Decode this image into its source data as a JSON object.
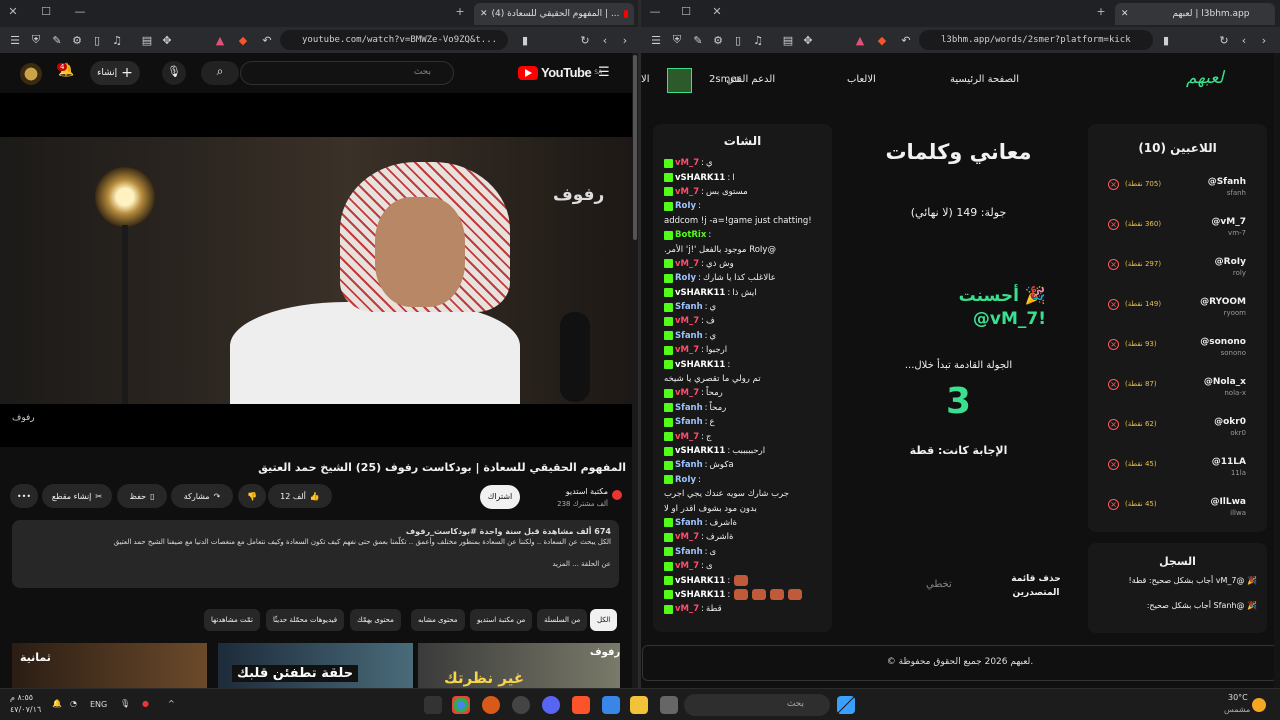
{
  "left_browser": {
    "tab_title": "(4) المفهوم الحقيقي للسعادة | ...",
    "url": "youtube.com/watch?v=BMWZe-Vo9ZQ&t...",
    "youtube": {
      "logo_text": "YouTube",
      "logo_region": "SA",
      "search_placeholder": "بحث",
      "create_label": "إنشاء",
      "notifications_count": "4"
    },
    "video": {
      "brand_overlay": "رفوف",
      "brand_small": "رفوف",
      "title": "المفهوم الحقيقي للسعادة | بودكاست رفوف (25) الشيخ حمد العتيق",
      "channel_name": "مكتبة استديو",
      "subscribers": "238 ألف مشترك",
      "join_label": "اشتراك",
      "likes": "12 ألف",
      "share_label": "مشاركة",
      "save_label": "حفظ",
      "clip_label": "إنشاء مقطع",
      "desc_stats": "674 ألف مشاهدة  قبل سنة واحدة  #بودكاست_رفوف",
      "desc_text": "الكل يبحث عن السعادة .. ولكننا عن السعادة بمنظور مختلف وأعمق .. تكلّمنا بعمق حتى نفهم كيف تكون السعادة وكيف نتعامل مع منغصات الدنيا مع ضيفنا الشيخ حمد العتيق",
      "desc_more": "عن الحلقة ... المزيد"
    },
    "chips": [
      "الكل",
      "من السلسلة",
      "من مكتبة استديو",
      "محتوى مشابه",
      "محتوى يهمّك",
      "فيديوهات محمّلة حديثًا",
      "تمّت مشاهدتها"
    ],
    "thumbs": [
      "ثمانية",
      "حلقة تطفئن قلبك",
      "غير نظرتك",
      "رفوف"
    ]
  },
  "right_browser": {
    "tab_title": "لعبهم | l3bhm.app",
    "url": "l3bhm.app/words/2smer?platform=kick",
    "site": {
      "logo": "لعبهم",
      "nav": [
        "الصفحة الرئيسية",
        "الالعاب",
        "الدعم الفني"
      ],
      "username": "2smer",
      "nav_more": "الا"
    },
    "chat": {
      "title": "الشات",
      "messages": [
        {
          "user": "vM_7",
          "text": "ي",
          "color": "#ff4d6d",
          "rtl": true
        },
        {
          "user": "vSHARK11",
          "text": "ا",
          "color": "#ffffff",
          "rtl": true
        },
        {
          "user": "vM_7",
          "text": "مستوى بس",
          "color": "#ff4d6d",
          "rtl": true
        },
        {
          "user": "RoIy",
          "text": "",
          "color": "#9ec3ff",
          "rtl": false
        },
        {
          "user": "",
          "text": "!addcom !j -a=!game just chatting",
          "color": "#ffffff",
          "rtl": false
        },
        {
          "user": "BotRix",
          "text": "",
          "color": "#53fc18",
          "rtl": false
        },
        {
          "user": "",
          "text": "@RoIy موجود بالفعل '!j' الأمر.",
          "color": "#ffffff",
          "rtl": false
        },
        {
          "user": "vM_7",
          "text": "وش ذي",
          "color": "#ff4d6d",
          "rtl": true
        },
        {
          "user": "RoIy",
          "text": "عالاغلب كذا يا شارك",
          "color": "#9ec3ff",
          "rtl": true
        },
        {
          "user": "vSHARK11",
          "text": "ايش ذا",
          "color": "#ffffff",
          "rtl": true
        },
        {
          "user": "Sfanh",
          "text": "ي",
          "color": "#9ec3ff",
          "rtl": true
        },
        {
          "user": "vM_7",
          "text": "ف",
          "color": "#ff4d6d",
          "rtl": true
        },
        {
          "user": "Sfanh",
          "text": "ي",
          "color": "#9ec3ff",
          "rtl": true
        },
        {
          "user": "vM_7",
          "text": "ارجبوا",
          "color": "#ff4d6d",
          "rtl": true
        },
        {
          "user": "vSHARK11",
          "text": "",
          "color": "#ffffff",
          "rtl": false
        },
        {
          "user": "",
          "text": "تم رولي ما تقصري يا شيخه",
          "color": "#ffffff",
          "rtl": true
        },
        {
          "user": "vM_7",
          "text": "رمحاً",
          "color": "#ff4d6d",
          "rtl": true
        },
        {
          "user": "Sfanh",
          "text": "رمحاً",
          "color": "#9ec3ff",
          "rtl": true
        },
        {
          "user": "Sfanh",
          "text": "ع",
          "color": "#9ec3ff",
          "rtl": true
        },
        {
          "user": "vM_7",
          "text": "ج",
          "color": "#ff4d6d",
          "rtl": true
        },
        {
          "user": "vSHARK11",
          "text": "ارحبببببب",
          "color": "#ffffff",
          "rtl": true
        },
        {
          "user": "Sfanh",
          "text": "aكوش",
          "color": "#9ec3ff",
          "rtl": true
        },
        {
          "user": "RoIy",
          "text": "",
          "color": "#9ec3ff",
          "rtl": false
        },
        {
          "user": "",
          "text": "جرب شارك سويه عندك يجي اجرب",
          "color": "#ffffff",
          "rtl": true
        },
        {
          "user": "",
          "text": "بدون مود بشوف اقدر او لا",
          "color": "#ffffff",
          "rtl": true
        },
        {
          "user": "Sfanh",
          "text": "ةاشرف",
          "color": "#9ec3ff",
          "rtl": true
        },
        {
          "user": "vM_7",
          "text": "ةاشرف",
          "color": "#ff4d6d",
          "rtl": true
        },
        {
          "user": "Sfanh",
          "text": "ى",
          "color": "#9ec3ff",
          "rtl": true
        },
        {
          "user": "vM_7",
          "text": "ى",
          "color": "#ff4d6d",
          "rtl": true
        },
        {
          "user": "vSHARK11",
          "text": "",
          "color": "#ffffff",
          "rtl": false,
          "emotes": 1
        },
        {
          "user": "vSHARK11",
          "text": "",
          "color": "#ffffff",
          "rtl": false,
          "emotes": 4
        },
        {
          "user": "vM_7",
          "text": "قطة",
          "color": "#ff4d6d",
          "rtl": true
        }
      ]
    },
    "game": {
      "title": "معاني وكلمات",
      "round": "جولة: 149 (لا نهائي)",
      "good_line1": "🎉 أحسنت",
      "good_line2": "@vM_7!",
      "next_round": "الجولة القادمة تبدأ خلال...",
      "countdown": "3",
      "answer": "الإجابة كانت: قطة",
      "skip_label": "تخطي",
      "clear_label": "حذف قائمة المتصدرين"
    },
    "players": {
      "title": "اللاعبين (10)",
      "list": [
        {
          "name": "@Sfanh",
          "sub": "sfanh",
          "points": "(705 نقطة)"
        },
        {
          "name": "@vM_7",
          "sub": "vm-7",
          "points": "(360 نقطة)"
        },
        {
          "name": "@RoIy",
          "sub": "roly",
          "points": "(297 نقطة)"
        },
        {
          "name": "@RYOOM",
          "sub": "ryoom",
          "points": "(149 نقطة)"
        },
        {
          "name": "@sonono",
          "sub": "sonono",
          "points": "(93 نقطة)"
        },
        {
          "name": "@Nola_x",
          "sub": "nola-x",
          "points": "(87 نقطة)"
        },
        {
          "name": "@okr0",
          "sub": "okr0",
          "points": "(62 نقطة)"
        },
        {
          "name": "@11LA",
          "sub": "11la",
          "points": "(45 نقطة)"
        },
        {
          "name": "@IlLwa",
          "sub": "illwa",
          "points": "(45 نقطة)"
        }
      ]
    },
    "log": {
      "title": "السجل",
      "lines": [
        "🎉 @vM_7 أجاب بشكل صحيح: قطة!",
        "🎉 @Sfanh أجاب بشكل صحيح:"
      ]
    },
    "footer": "© لعبهم 2026 جميع الحقوق محفوظة."
  },
  "taskbar": {
    "search_placeholder": "بحث",
    "lang": "ENG",
    "weather_temp": "30°C",
    "weather_desc": "مشمس",
    "time": "٨:٥٥ م",
    "date": "٤٧/٠٧/١٦"
  },
  "colors": {
    "accent_green": "#3be08f",
    "kick_green": "#53fc18",
    "youtube_red": "#ff0000"
  }
}
